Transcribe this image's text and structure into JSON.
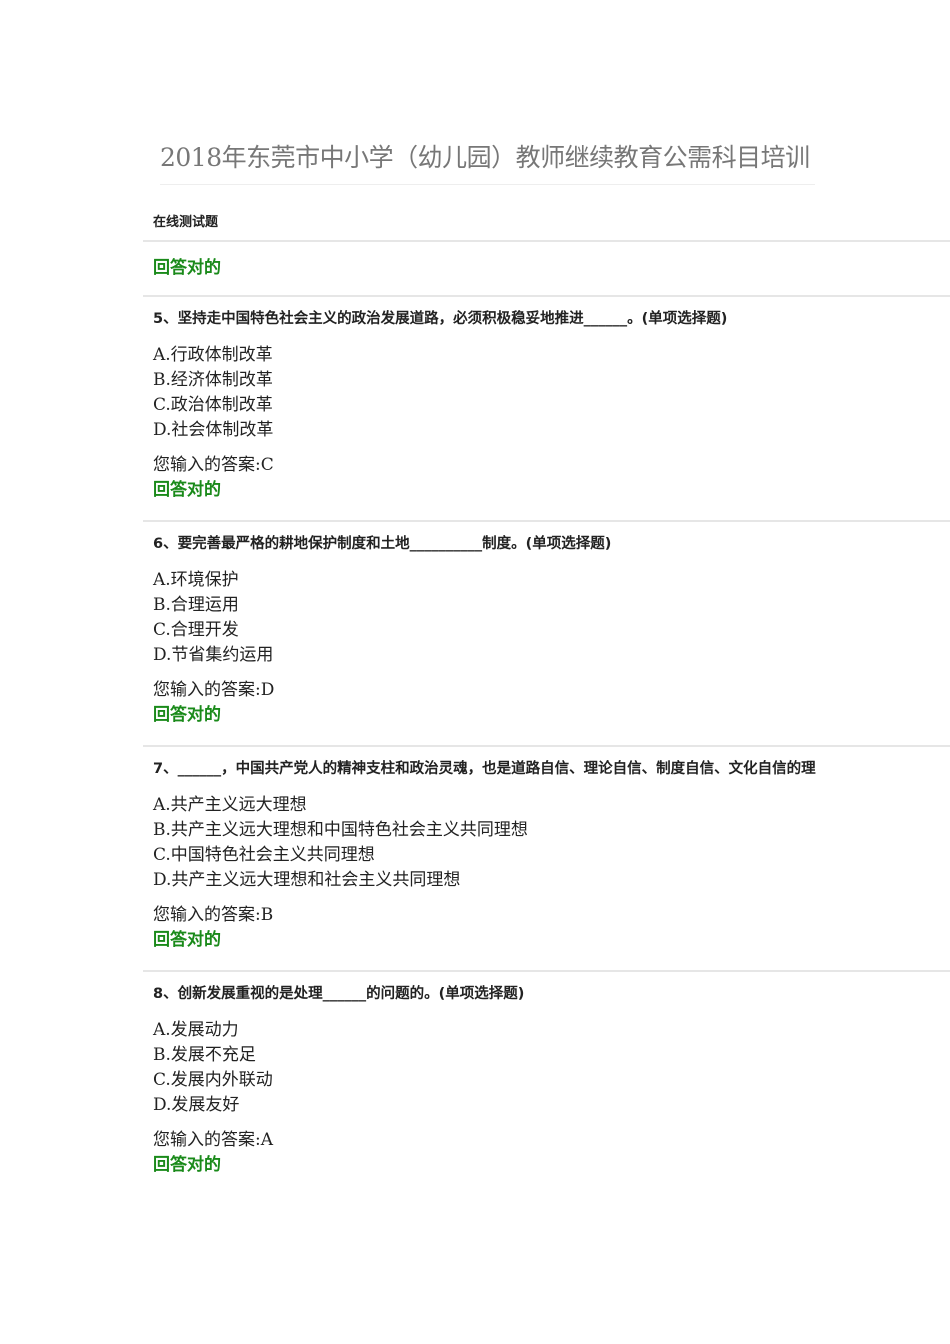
{
  "title": "2018年东莞市中小学（幼儿园）教师继续教育公需科目培训",
  "subtitle": "在线测试题",
  "prev_result": "回答对的",
  "questions": [
    {
      "text": "5、坚持走中国特色社会主义的政治发展道路，必须积极稳妥地推进______。(单项选择题)",
      "options": [
        "A.行政体制改革",
        "B.经济体制改革",
        "C.政治体制改革",
        "D.社会体制改革"
      ],
      "answer": "您输入的答案:C",
      "result": "回答对的"
    },
    {
      "text": "6、要完善最严格的耕地保护制度和土地__________制度。(单项选择题)",
      "options": [
        "A.环境保护",
        "B.合理运用",
        "C.合理开发",
        "D.节省集约运用"
      ],
      "answer": "您输入的答案:D",
      "result": "回答对的"
    },
    {
      "text": "7、______，中国共产党人的精神支柱和政治灵魂，也是道路自信、理论自信、制度自信、文化自信的理",
      "options": [
        "A.共产主义远大理想",
        "B.共产主义远大理想和中国特色社会主义共同理想",
        "C.中国特色社会主义共同理想",
        "D.共产主义远大理想和社会主义共同理想"
      ],
      "answer": "您输入的答案:B",
      "result": "回答对的"
    },
    {
      "text": "8、创新发展重视的是处理______的问题的。(单项选择题)",
      "options": [
        "A.发展动力",
        "B.发展不充足",
        "C.发展内外联动",
        "D.发展友好"
      ],
      "answer": "您输入的答案:A",
      "result": "回答对的"
    }
  ]
}
